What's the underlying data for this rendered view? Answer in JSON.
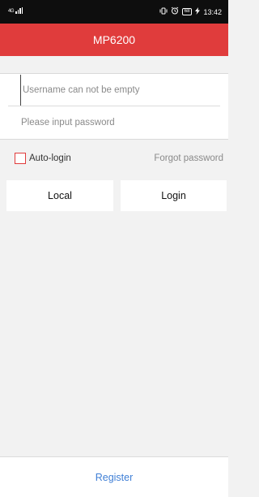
{
  "status_bar": {
    "signal_label": "4G",
    "vibrate_icon": "vibrate-icon",
    "alarm_icon": "alarm-clock-icon",
    "battery_level": "68",
    "charging_icon": "bolt-icon",
    "time": "13:42"
  },
  "header": {
    "title": "MP6200",
    "background_color": "#e03c3c"
  },
  "login_form": {
    "username_value": "",
    "username_placeholder": "Username can not be empty",
    "password_value": "",
    "password_placeholder": "Please input password",
    "auto_login_label": "Auto-login",
    "auto_login_checked": false,
    "forgot_password_label": "Forgot password"
  },
  "buttons": {
    "local_label": "Local",
    "login_label": "Login"
  },
  "footer": {
    "register_label": "Register",
    "register_color": "#3f7fd6"
  }
}
